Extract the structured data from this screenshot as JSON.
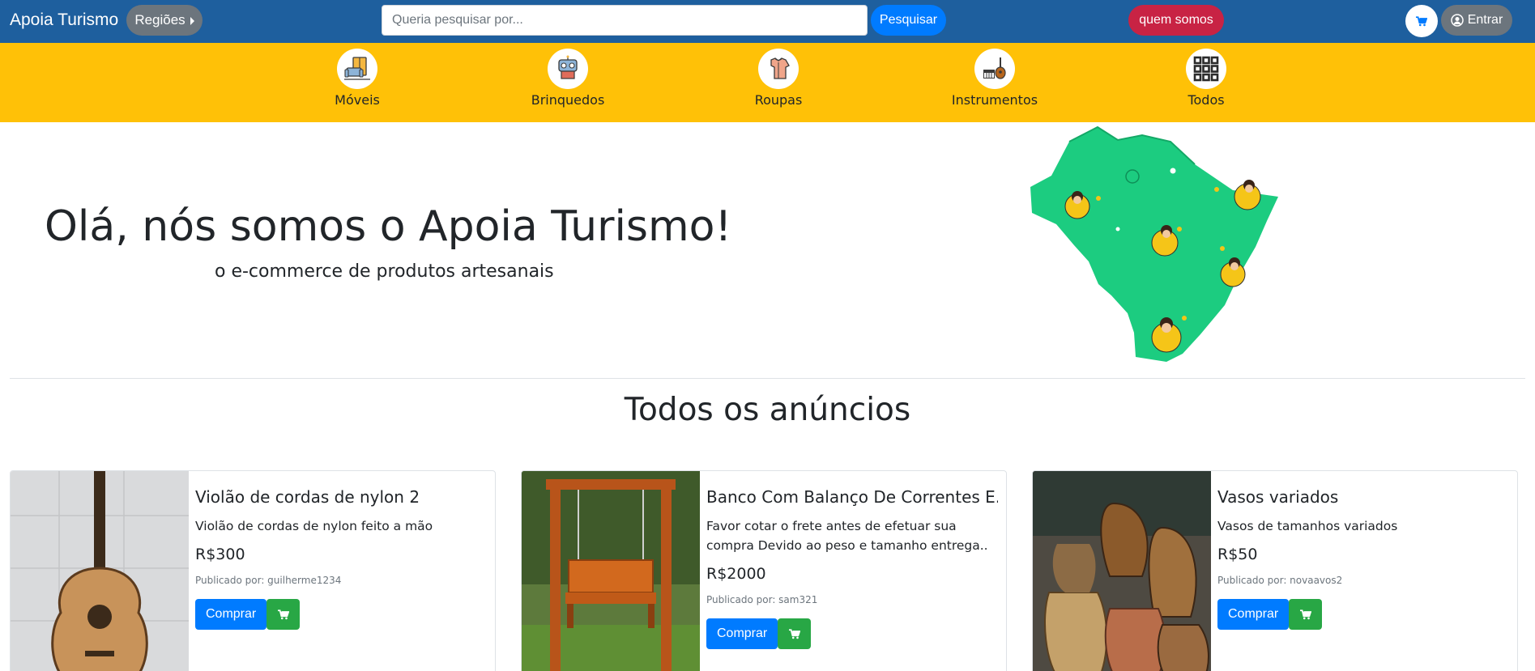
{
  "navbar": {
    "brand": "Apoia Turismo",
    "regions_label": "Regiões",
    "search_placeholder": "Queria pesquisar por...",
    "search_button": "Pesquisar",
    "about_button": "quem somos",
    "login_button": "Entrar",
    "colors": {
      "background": "#1e5f9e",
      "about": "#c82344",
      "search": "#007bff",
      "secondary": "#6c757d"
    }
  },
  "categories": [
    {
      "label": "Móveis",
      "icon": "furniture-icon"
    },
    {
      "label": "Brinquedos",
      "icon": "toys-icon"
    },
    {
      "label": "Roupas",
      "icon": "clothes-icon"
    },
    {
      "label": "Instrumentos",
      "icon": "instruments-icon"
    },
    {
      "label": "Todos",
      "icon": "grid-icon"
    }
  ],
  "hero": {
    "title": "Olá, nós somos o Apoia Turismo!",
    "subtitle": "o e-commerce de produtos artesanais",
    "illustration": "brazil-map-illustration"
  },
  "section_title": "Todos os anúncios",
  "products": [
    {
      "title": "Violão de cordas de nylon 2",
      "description": "Violão de cordas de nylon feito a mão",
      "price": "R$300",
      "author": "Publicado por: guilherme1234",
      "buy_label": "Comprar",
      "image": "guitar-image"
    },
    {
      "title": "Banco Com Balanço De Correntes E..",
      "description": "Favor cotar o frete antes de efetuar sua compra Devido ao peso e tamanho entrega..",
      "price": "R$2000",
      "author": "Publicado por: sam321",
      "buy_label": "Comprar",
      "image": "wooden-swing-image"
    },
    {
      "title": "Vasos variados",
      "description": "Vasos de tamanhos variados",
      "price": "R$50",
      "author": "Publicado por: novaavos2",
      "buy_label": "Comprar",
      "image": "vases-image"
    }
  ],
  "colors": {
    "category_bar": "#ffc107",
    "buy": "#007bff",
    "cart": "#28a745"
  }
}
